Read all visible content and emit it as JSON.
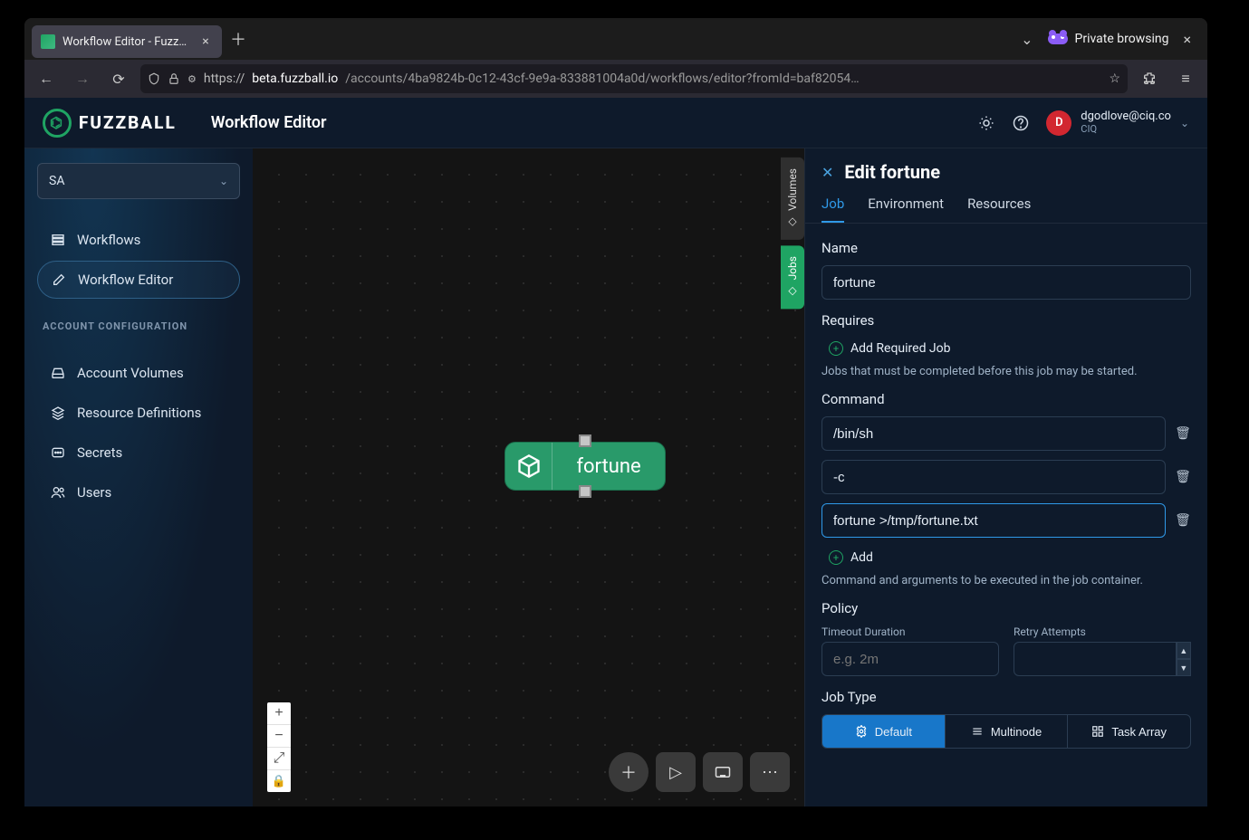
{
  "browser": {
    "tab_title": "Workflow Editor - Fuzzb…",
    "private_label": "Private browsing",
    "url_proto": "https://",
    "url_host": "beta.fuzzball.io",
    "url_rest": "/accounts/4ba9824b-0c12-43cf-9e9a-833881004a0d/workflows/editor?fromId=baf82054…"
  },
  "header": {
    "brand": "FUZZBALL",
    "page_title": "Workflow Editor",
    "avatar_initial": "D",
    "user_email": "dgodlove@ciq.co",
    "user_org": "CIQ"
  },
  "sidebar": {
    "project": "SA",
    "items": [
      {
        "icon": "list",
        "label": "Workflows"
      },
      {
        "icon": "edit",
        "label": "Workflow Editor"
      }
    ],
    "section": "ACCOUNT CONFIGURATION",
    "account_items": [
      {
        "icon": "drive",
        "label": "Account Volumes"
      },
      {
        "icon": "stack",
        "label": "Resource Definitions"
      },
      {
        "icon": "key",
        "label": "Secrets"
      },
      {
        "icon": "users",
        "label": "Users"
      }
    ]
  },
  "rail": {
    "volumes": "Volumes",
    "jobs": "Jobs"
  },
  "canvas": {
    "node_label": "fortune"
  },
  "panel": {
    "title": "Edit fortune",
    "tabs": {
      "job": "Job",
      "env": "Environment",
      "res": "Resources"
    },
    "name_label": "Name",
    "name_value": "fortune",
    "requires_label": "Requires",
    "add_required": "Add Required Job",
    "requires_hint": "Jobs that must be completed before this job may be started.",
    "command_label": "Command",
    "cmd": [
      "/bin/sh",
      "-c",
      "fortune >/tmp/fortune.txt"
    ],
    "add_cmd": "Add",
    "command_hint": "Command and arguments to be executed in the job container.",
    "policy_label": "Policy",
    "timeout_label": "Timeout Duration",
    "timeout_placeholder": "e.g. 2m",
    "retry_label": "Retry Attempts",
    "jobtype_label": "Job Type",
    "jobtype": {
      "default": "Default",
      "multi": "Multinode",
      "array": "Task Array"
    }
  }
}
